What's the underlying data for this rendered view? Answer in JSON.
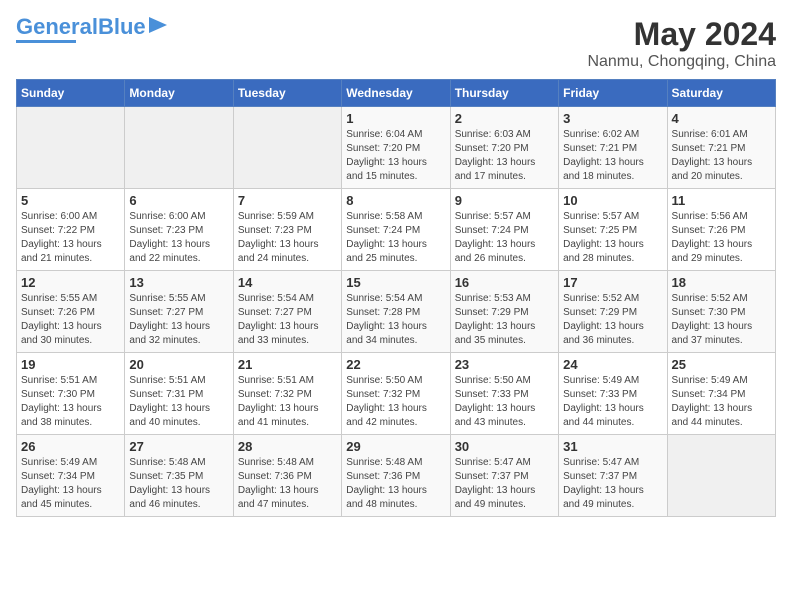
{
  "header": {
    "logo_text_general": "General",
    "logo_text_blue": "Blue",
    "month": "May 2024",
    "location": "Nanmu, Chongqing, China"
  },
  "weekdays": [
    "Sunday",
    "Monday",
    "Tuesday",
    "Wednesday",
    "Thursday",
    "Friday",
    "Saturday"
  ],
  "weeks": [
    [
      {
        "day": "",
        "info": ""
      },
      {
        "day": "",
        "info": ""
      },
      {
        "day": "",
        "info": ""
      },
      {
        "day": "1",
        "info": "Sunrise: 6:04 AM\nSunset: 7:20 PM\nDaylight: 13 hours\nand 15 minutes."
      },
      {
        "day": "2",
        "info": "Sunrise: 6:03 AM\nSunset: 7:20 PM\nDaylight: 13 hours\nand 17 minutes."
      },
      {
        "day": "3",
        "info": "Sunrise: 6:02 AM\nSunset: 7:21 PM\nDaylight: 13 hours\nand 18 minutes."
      },
      {
        "day": "4",
        "info": "Sunrise: 6:01 AM\nSunset: 7:21 PM\nDaylight: 13 hours\nand 20 minutes."
      }
    ],
    [
      {
        "day": "5",
        "info": "Sunrise: 6:00 AM\nSunset: 7:22 PM\nDaylight: 13 hours\nand 21 minutes."
      },
      {
        "day": "6",
        "info": "Sunrise: 6:00 AM\nSunset: 7:23 PM\nDaylight: 13 hours\nand 22 minutes."
      },
      {
        "day": "7",
        "info": "Sunrise: 5:59 AM\nSunset: 7:23 PM\nDaylight: 13 hours\nand 24 minutes."
      },
      {
        "day": "8",
        "info": "Sunrise: 5:58 AM\nSunset: 7:24 PM\nDaylight: 13 hours\nand 25 minutes."
      },
      {
        "day": "9",
        "info": "Sunrise: 5:57 AM\nSunset: 7:24 PM\nDaylight: 13 hours\nand 26 minutes."
      },
      {
        "day": "10",
        "info": "Sunrise: 5:57 AM\nSunset: 7:25 PM\nDaylight: 13 hours\nand 28 minutes."
      },
      {
        "day": "11",
        "info": "Sunrise: 5:56 AM\nSunset: 7:26 PM\nDaylight: 13 hours\nand 29 minutes."
      }
    ],
    [
      {
        "day": "12",
        "info": "Sunrise: 5:55 AM\nSunset: 7:26 PM\nDaylight: 13 hours\nand 30 minutes."
      },
      {
        "day": "13",
        "info": "Sunrise: 5:55 AM\nSunset: 7:27 PM\nDaylight: 13 hours\nand 32 minutes."
      },
      {
        "day": "14",
        "info": "Sunrise: 5:54 AM\nSunset: 7:27 PM\nDaylight: 13 hours\nand 33 minutes."
      },
      {
        "day": "15",
        "info": "Sunrise: 5:54 AM\nSunset: 7:28 PM\nDaylight: 13 hours\nand 34 minutes."
      },
      {
        "day": "16",
        "info": "Sunrise: 5:53 AM\nSunset: 7:29 PM\nDaylight: 13 hours\nand 35 minutes."
      },
      {
        "day": "17",
        "info": "Sunrise: 5:52 AM\nSunset: 7:29 PM\nDaylight: 13 hours\nand 36 minutes."
      },
      {
        "day": "18",
        "info": "Sunrise: 5:52 AM\nSunset: 7:30 PM\nDaylight: 13 hours\nand 37 minutes."
      }
    ],
    [
      {
        "day": "19",
        "info": "Sunrise: 5:51 AM\nSunset: 7:30 PM\nDaylight: 13 hours\nand 38 minutes."
      },
      {
        "day": "20",
        "info": "Sunrise: 5:51 AM\nSunset: 7:31 PM\nDaylight: 13 hours\nand 40 minutes."
      },
      {
        "day": "21",
        "info": "Sunrise: 5:51 AM\nSunset: 7:32 PM\nDaylight: 13 hours\nand 41 minutes."
      },
      {
        "day": "22",
        "info": "Sunrise: 5:50 AM\nSunset: 7:32 PM\nDaylight: 13 hours\nand 42 minutes."
      },
      {
        "day": "23",
        "info": "Sunrise: 5:50 AM\nSunset: 7:33 PM\nDaylight: 13 hours\nand 43 minutes."
      },
      {
        "day": "24",
        "info": "Sunrise: 5:49 AM\nSunset: 7:33 PM\nDaylight: 13 hours\nand 44 minutes."
      },
      {
        "day": "25",
        "info": "Sunrise: 5:49 AM\nSunset: 7:34 PM\nDaylight: 13 hours\nand 44 minutes."
      }
    ],
    [
      {
        "day": "26",
        "info": "Sunrise: 5:49 AM\nSunset: 7:34 PM\nDaylight: 13 hours\nand 45 minutes."
      },
      {
        "day": "27",
        "info": "Sunrise: 5:48 AM\nSunset: 7:35 PM\nDaylight: 13 hours\nand 46 minutes."
      },
      {
        "day": "28",
        "info": "Sunrise: 5:48 AM\nSunset: 7:36 PM\nDaylight: 13 hours\nand 47 minutes."
      },
      {
        "day": "29",
        "info": "Sunrise: 5:48 AM\nSunset: 7:36 PM\nDaylight: 13 hours\nand 48 minutes."
      },
      {
        "day": "30",
        "info": "Sunrise: 5:47 AM\nSunset: 7:37 PM\nDaylight: 13 hours\nand 49 minutes."
      },
      {
        "day": "31",
        "info": "Sunrise: 5:47 AM\nSunset: 7:37 PM\nDaylight: 13 hours\nand 49 minutes."
      },
      {
        "day": "",
        "info": ""
      }
    ]
  ]
}
